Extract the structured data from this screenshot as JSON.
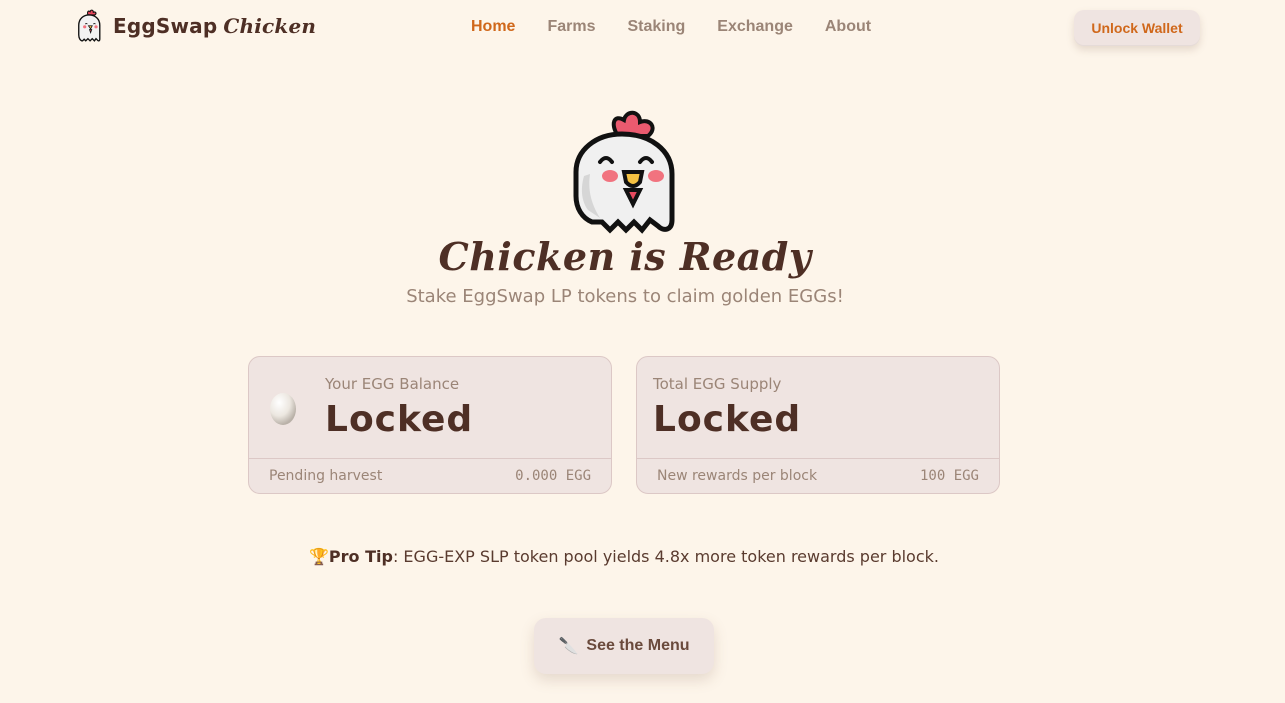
{
  "brand": {
    "part1": "EggSwap",
    "part2": "Chicken",
    "logo_icon": "chicken-icon"
  },
  "nav": {
    "items": [
      {
        "label": "Home",
        "active": true
      },
      {
        "label": "Farms",
        "active": false
      },
      {
        "label": "Staking",
        "active": false
      },
      {
        "label": "Exchange",
        "active": false
      },
      {
        "label": "About",
        "active": false
      }
    ]
  },
  "header": {
    "unlock_label": "Unlock Wallet"
  },
  "hero": {
    "icon": "chicken-icon",
    "title": "Chicken is Ready",
    "subtitle": "Stake EggSwap LP tokens to claim golden EGGs!"
  },
  "cards": {
    "balance": {
      "icon": "egg-icon",
      "label": "Your EGG Balance",
      "value": "Locked",
      "footer_label": "Pending harvest",
      "footer_value": "0.000 EGG"
    },
    "supply": {
      "label": "Total EGG Supply",
      "value": "Locked",
      "footer_label": "New rewards per block",
      "footer_value": "100 EGG"
    }
  },
  "tip": {
    "icon": "trophy-icon",
    "emoji": "🏆",
    "bold": "Pro Tip",
    "text": ": EGG-EXP SLP token pool yields 4.8x more token rewards per block."
  },
  "menu_button": {
    "icon": "knife-icon",
    "emoji": "🔪",
    "label": "See the Menu"
  },
  "colors": {
    "background": "#fdf5ea",
    "accent": "#d0681b",
    "text_dark": "#4e2f25",
    "text_muted": "#9b8577",
    "card_bg": "#efe4e1"
  }
}
